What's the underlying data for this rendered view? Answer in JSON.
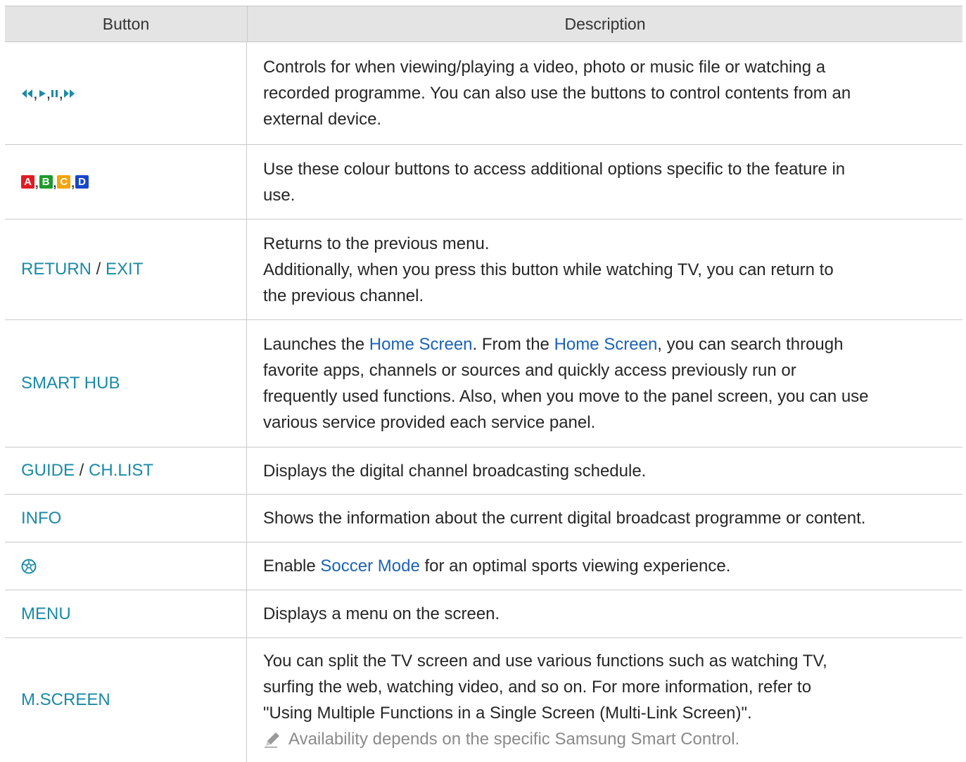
{
  "header": {
    "col1": "Button",
    "col2": "Description"
  },
  "colors": {
    "accent": "#1a8aa5",
    "link": "#1b62b8",
    "red": "#e21b23",
    "green": "#1f9a2c",
    "yellow": "#f5a40c",
    "blue": "#1747c9"
  },
  "rows": [
    {
      "desc": [
        "Controls for when viewing/playing a video, photo or music file or watching a",
        "recorded programme. You can also use the buttons to control contents from an",
        "external device."
      ],
      "icons": [
        "rewind-icon",
        "play-icon",
        "pause-icon",
        "fast-forward-icon"
      ]
    },
    {
      "color_buttons": [
        "A",
        "B",
        "C",
        "D"
      ],
      "desc": [
        "Use these colour buttons to access additional options specific to the feature in",
        "use."
      ]
    },
    {
      "btn1": "RETURN",
      "sep": " / ",
      "btn2": "EXIT",
      "desc": [
        "Returns to the previous menu.",
        "Additionally, when you press this button while watching TV, you can return to",
        "the previous channel."
      ]
    },
    {
      "btn1": "SMART HUB",
      "desc_parts": [
        "Launches the ",
        "Home Screen",
        ". From the ",
        "Home Screen",
        ", you can search through"
      ],
      "desc": [
        "favorite apps, channels or sources and quickly access previously run or",
        "frequently used functions. Also, when you move to the panel screen, you can use",
        "various service provided each service panel."
      ]
    },
    {
      "btn1": "GUIDE",
      "sep": " / ",
      "btn2": "CH.LIST",
      "desc": [
        "Displays the digital channel broadcasting schedule."
      ]
    },
    {
      "btn1": "INFO",
      "desc": [
        "Shows the information about the current digital broadcast programme or content."
      ]
    },
    {
      "icon": "soccer-ball-icon",
      "desc_parts": [
        "Enable ",
        "Soccer Mode",
        " for an optimal sports viewing experience."
      ]
    },
    {
      "btn1": "MENU",
      "desc": [
        "Displays a menu on the screen."
      ]
    },
    {
      "btn1": "M.SCREEN",
      "desc": [
        "You can split the TV screen and use various functions such as watching TV,",
        "surfing the web, watching video, and so on. For more information, refer to",
        "\"Using Multiple Functions in a Single Screen (Multi-Link Screen)\"."
      ],
      "note": "Availability depends on the specific Samsung Smart Control."
    }
  ],
  "punct": {
    "comma": ", "
  }
}
